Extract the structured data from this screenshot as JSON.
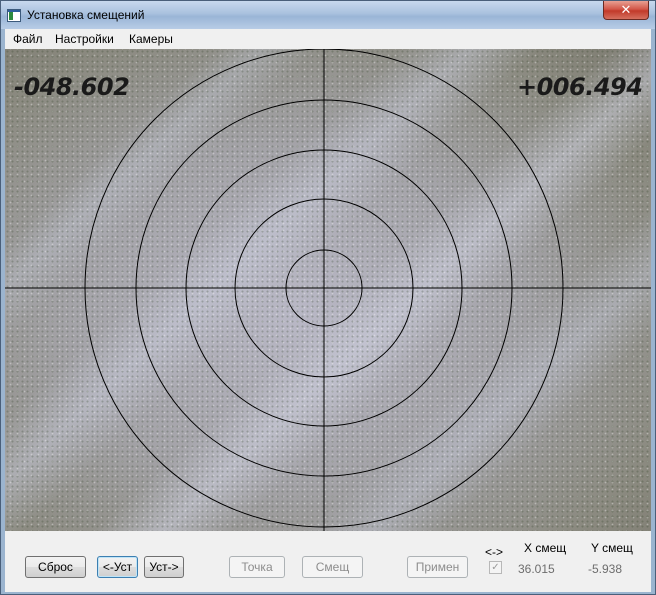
{
  "window": {
    "title": "Установка смещений",
    "close_glyph": "✕"
  },
  "menu": {
    "items": [
      "Файл",
      "Настройки",
      "Камеры"
    ]
  },
  "camera": {
    "x_readout": "-048.602",
    "y_readout": "+006.494"
  },
  "buttons": {
    "reset": "Сброс",
    "set_left": "<-Уст",
    "set_right": "Уст->",
    "point": "Точка",
    "offset": "Смещ",
    "apply": "Примен"
  },
  "offsets": {
    "swap_label": "<->",
    "swap_checked": true,
    "x_header": "X смещ",
    "y_header": "Y смещ",
    "x_value": "36.015",
    "y_value": "-5.938"
  },
  "colors": {
    "reticle": "#000000",
    "titlebar": "#a9c1de",
    "close": "#c23a2a"
  },
  "icons": {
    "app": "app-icon",
    "close": "close-icon",
    "check": "checkbox-checked-icon"
  }
}
